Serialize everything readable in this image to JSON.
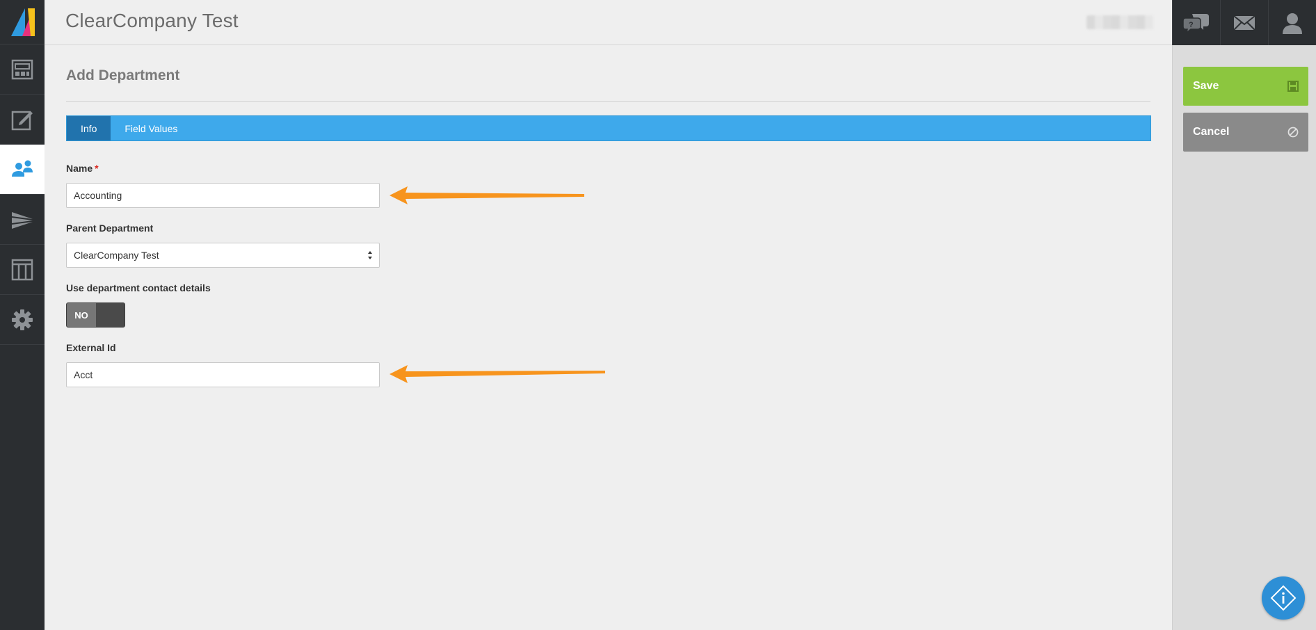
{
  "header": {
    "company_title": "ClearCompany Test"
  },
  "nav": {
    "items": [
      {
        "icon": "dashboard-icon"
      },
      {
        "icon": "edit-document-icon"
      },
      {
        "icon": "users-icon",
        "active": true
      },
      {
        "icon": "paper-plane-icon"
      },
      {
        "icon": "columns-icon"
      },
      {
        "icon": "gear-icon"
      }
    ]
  },
  "topbar": {
    "icons": [
      "chat-help-icon",
      "mail-icon",
      "user-profile-icon"
    ]
  },
  "page": {
    "title": "Add Department"
  },
  "tabs": [
    {
      "label": "Info",
      "active": true
    },
    {
      "label": "Field Values",
      "active": false
    }
  ],
  "form": {
    "name_label": "Name",
    "name_required": "*",
    "name_value": "Accounting",
    "parent_label": "Parent Department",
    "parent_value": "ClearCompany Test",
    "contact_label": "Use department contact details",
    "contact_toggle": "NO",
    "external_label": "External Id",
    "external_value": "Acct"
  },
  "actions": {
    "save_label": "Save",
    "cancel_label": "Cancel"
  },
  "colors": {
    "accent": "#3ea9eb",
    "tab_active": "#2173ad",
    "save": "#8cc63f",
    "cancel": "#8a8a8a",
    "annotation_arrow": "#f7941d"
  }
}
